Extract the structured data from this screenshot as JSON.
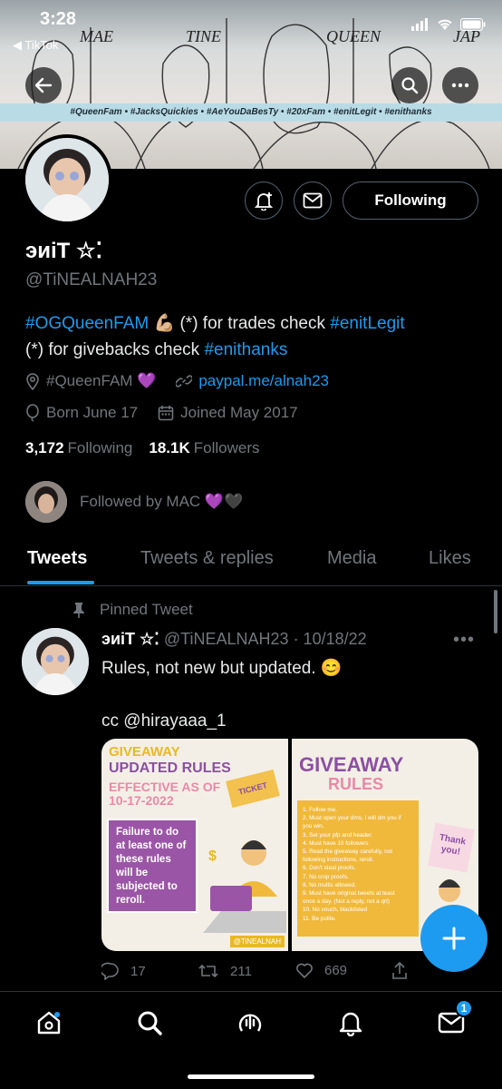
{
  "status_bar": {
    "time": "3:28",
    "back_app": "◀ TikTok"
  },
  "banner": {
    "hashtags": "#QueenFam • #JacksQuickies • #AeYouDaBesTy  • #20xFam • #enitLegit • #enithanks",
    "sketch_labels": [
      "MAE",
      "TINE",
      "QUEEN",
      "JAP"
    ]
  },
  "profile": {
    "display_name": "эиiT ☆⁚",
    "handle": "@TiNEALNAH23",
    "following_button": "Following",
    "bio_line1_tag": "#OGQueenFAM",
    "bio_line1_emoji": "💪🏼",
    "bio_line1_text": " (*) for trades check ",
    "bio_line1_tag2": "#enitLegit",
    "bio_line2_text": "(*) for givebacks check ",
    "bio_line2_tag": "#enithanks",
    "location": "#QueenFAM 💜",
    "website": "paypal.me/alnah23",
    "birthday": "Born June 17",
    "joined": "Joined May 2017",
    "following_count": "3,172",
    "following_label": "Following",
    "followers_count": "18.1K",
    "followers_label": "Followers",
    "followed_by": "Followed by MAC 💜🖤"
  },
  "tabs": [
    "Tweets",
    "Tweets & replies",
    "Media",
    "Likes"
  ],
  "tweet": {
    "pinned_label": "Pinned Tweet",
    "author_name": "эиiT ☆⁚",
    "author_handle": "@TiNEALNAH23",
    "date": "· 10/18/22",
    "text": "Rules, not new but updated. 😊\n\ncc @hirayaaa_1",
    "media_left": {
      "title": "GIVEAWAY",
      "subtitle": "UPDATED RULES",
      "effective": "EFFECTIVE AS OF 10-17-2022",
      "ticket": "TICKET",
      "fail_text": "Failure to do at least one of these rules will be subjected to reroll.",
      "tag": "@TiNEALNAH"
    },
    "media_right": {
      "title": "GIVEAWAY",
      "subtitle": "RULES",
      "thank": "Thank you!",
      "rules": [
        "1. Follow me.",
        "2. Must open your dms, I will dm you if",
        "   you win.",
        "3. Set your pfp and header.",
        "4. Must have 10 followers",
        "5. Read the giveaway carefully, not",
        "   following instructions, reroll.",
        "6. Don't steal proofs.",
        "7. No crop proofs.",
        "8. No multis allowed.",
        "9. Must have original tweets at least",
        "   once a day. (Not a reply, not a qrt)",
        "10. No vouch, blacklisted",
        "11. Be polite."
      ]
    },
    "replies": "17",
    "retweets": "211",
    "likes": "669"
  },
  "nav": {
    "messages_badge": "1"
  },
  "colors": {
    "accent": "#1d9bf0",
    "muted": "#71767b",
    "background": "#000000"
  }
}
